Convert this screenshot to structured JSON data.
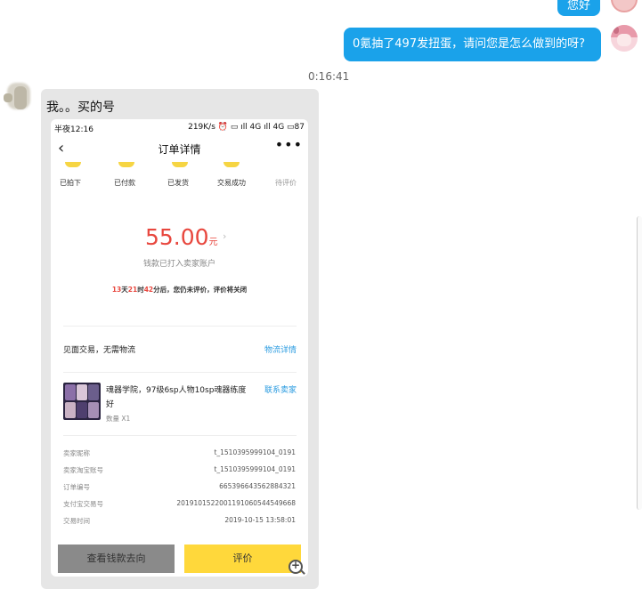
{
  "chat": {
    "top_bubble": "您好",
    "question": "0氪抽了497发扭蛋，请问您是怎么做到的呀?",
    "timestamp": "0:16:41",
    "reply_text": "我。。买的号"
  },
  "phone": {
    "status_left": "半夜12:16",
    "status_right": "219K/s ⏰ ▭ ıll 4G ıll 4G ▭87",
    "nav_title": "订单详情",
    "back_glyph": "‹",
    "more_glyph": "•••",
    "steps": [
      "已拍下",
      "已付款",
      "已发货",
      "交易成功",
      "待评价"
    ],
    "amount": "55.00",
    "amount_unit": "元",
    "amount_sub": "钱款已打入卖家账户",
    "countdown": {
      "days": "13",
      "days_unit": "天",
      "hours": "21",
      "hours_unit": "时",
      "minutes": "42",
      "suffix": "分后，您仍未评价，评价将关闭"
    },
    "delivery_label": "见面交易，无需物流",
    "delivery_link": "物流详情",
    "product_name": "魂器学院，97级6sp人物10sp魂器练度好",
    "contact_link": "联系卖家",
    "product_qty": "数量 X1",
    "info": [
      {
        "k": "卖家昵称",
        "v": "t_1510395999104_0191"
      },
      {
        "k": "卖家淘宝账号",
        "v": "t_1510395999104_0191"
      },
      {
        "k": "订单编号",
        "v": "665396643562884321"
      },
      {
        "k": "支付宝交易号",
        "v": "2019101522001191060544549668"
      },
      {
        "k": "交易时间",
        "v": "2019-10-15 13:58:01"
      }
    ],
    "btn_money": "查看钱款去向",
    "btn_rate": "评价"
  },
  "colors": {
    "bubble": "#1aa2ea",
    "price_red": "#e8473e",
    "link_blue": "#2a9be0",
    "yellow": "#ffd83b"
  },
  "icons": {
    "zoom": "zoom-in-icon",
    "back": "chevron-left-icon",
    "more": "more-dots-icon"
  }
}
